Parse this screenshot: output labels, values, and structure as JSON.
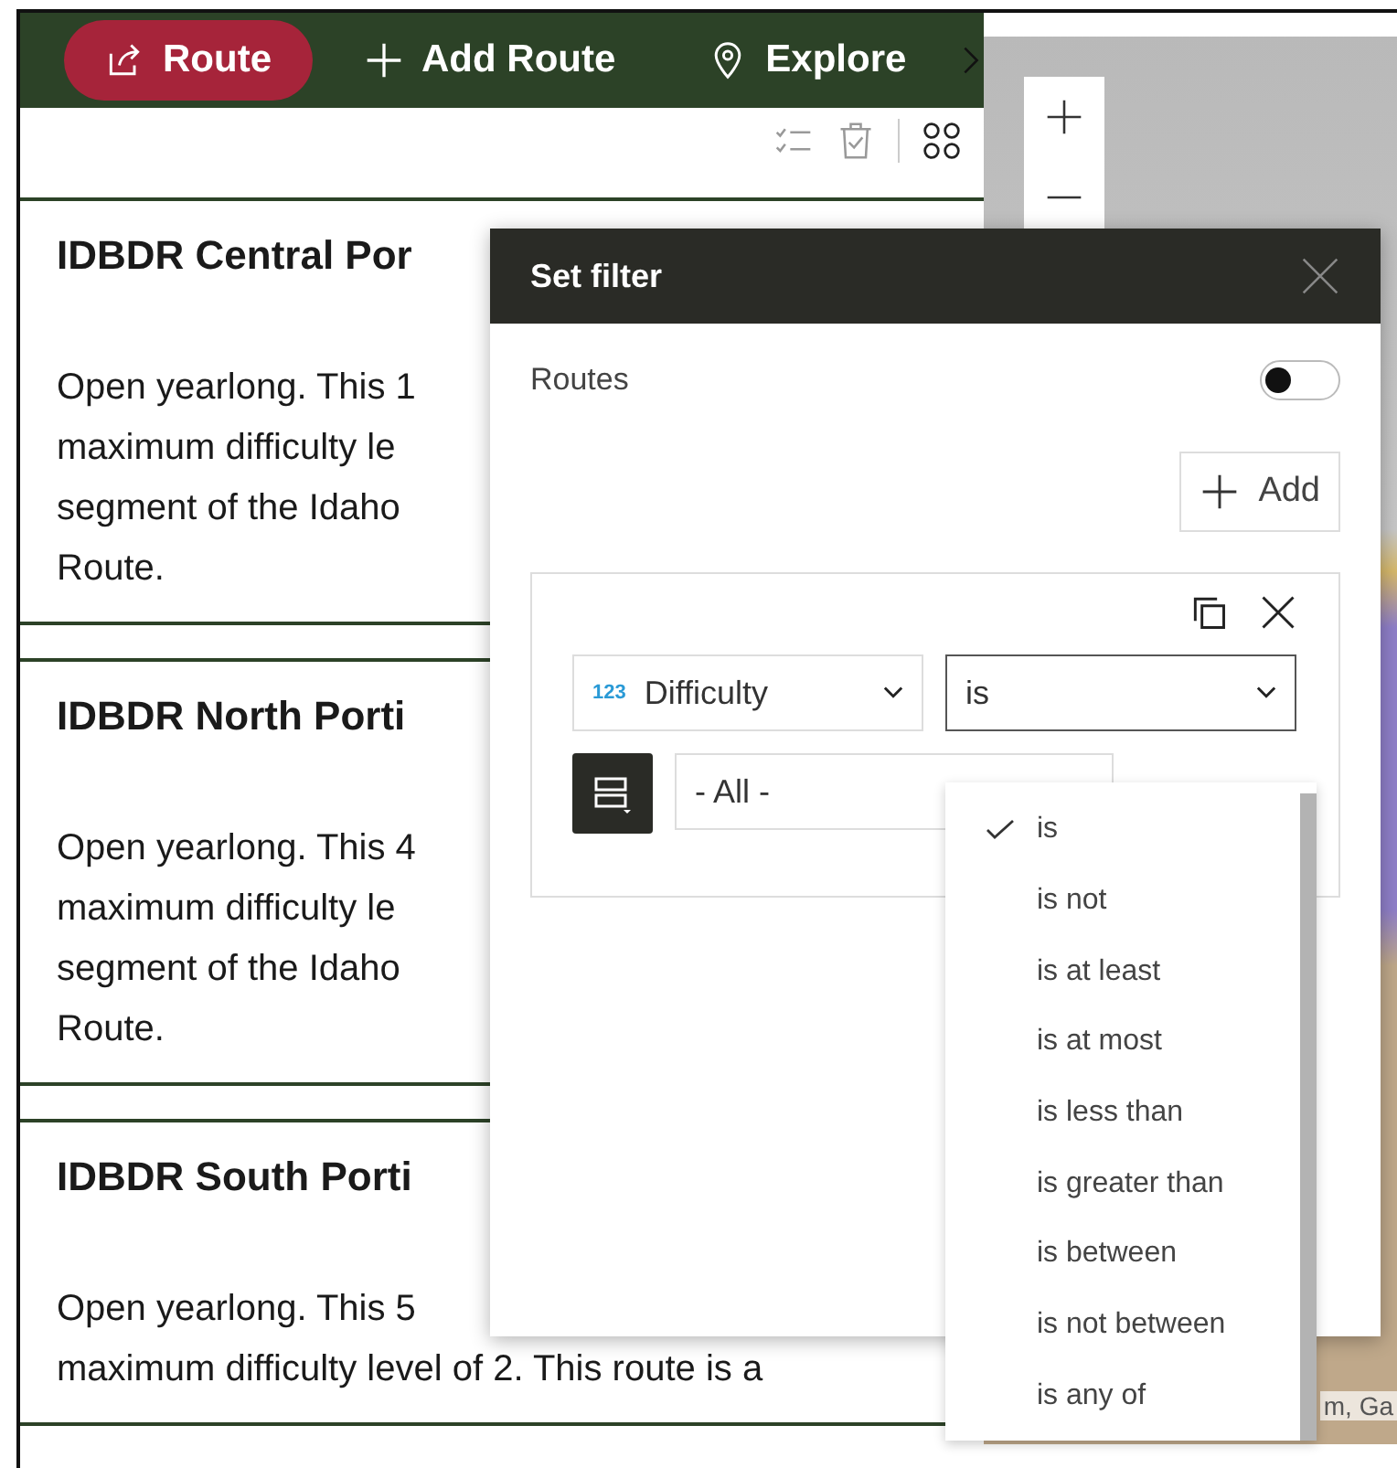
{
  "nav": {
    "items": [
      {
        "kind": "share",
        "label": "Route",
        "selected": true
      },
      {
        "kind": "plus",
        "label": "Add Route",
        "selected": false
      },
      {
        "kind": "pin",
        "label": "Explore",
        "selected": false
      }
    ]
  },
  "routes": [
    {
      "title": "IDBDR Central Por",
      "lines": [
        "Open yearlong. This 1",
        "maximum difficulty le",
        "segment of the Idaho",
        "Route."
      ]
    },
    {
      "title": "IDBDR North Porti",
      "lines": [
        "Open yearlong. This 4",
        "maximum difficulty le",
        "segment of the Idaho",
        "Route."
      ]
    },
    {
      "title": "IDBDR South Porti",
      "lines": [
        "Open yearlong. This 5",
        "maximum difficulty level of 2. This route is a"
      ]
    }
  ],
  "filter_dialog": {
    "title": "Set filter",
    "layer_label": "Routes",
    "toggle_on": false,
    "add_button": "Add",
    "condition": {
      "field_type": "123",
      "field": "Difficulty",
      "operator": "is",
      "value": "- All -"
    },
    "operator_options": [
      {
        "label": "is",
        "selected": true
      },
      {
        "label": "is not",
        "selected": false
      },
      {
        "label": "is at least",
        "selected": false
      },
      {
        "label": "is at most",
        "selected": false
      },
      {
        "label": "is less than",
        "selected": false
      },
      {
        "label": "is greater than",
        "selected": false
      },
      {
        "label": "is between",
        "selected": false
      },
      {
        "label": "is not between",
        "selected": false
      },
      {
        "label": "is any of",
        "selected": false
      }
    ]
  },
  "map": {
    "attribution": "m, Ga"
  }
}
